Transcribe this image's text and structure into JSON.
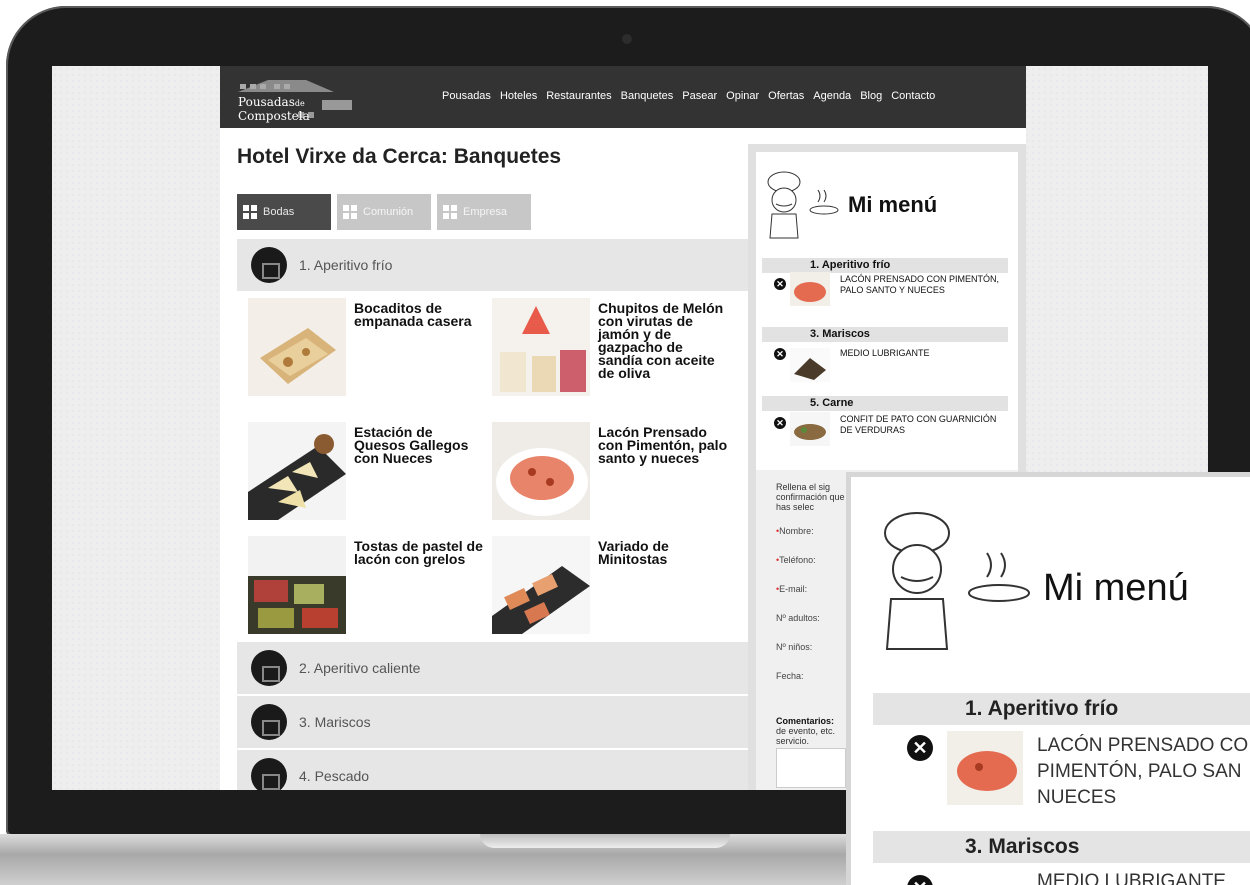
{
  "site": {
    "logo_text_line1": "Pousadas",
    "logo_text_de": "de",
    "logo_text_line2": "Compostela",
    "nav": [
      "Pousadas",
      "Hoteles",
      "Restaurantes",
      "Banquetes",
      "Pasear",
      "Opinar",
      "Ofertas",
      "Agenda",
      "Blog",
      "Contacto"
    ]
  },
  "page": {
    "title": "Hotel Virxe da Cerca: Banquetes",
    "tabs": [
      "Bodas",
      "Comunión",
      "Empresa"
    ],
    "active_tab": "Bodas",
    "sections": [
      "1. Aperitivo frío",
      "2. Aperitivo caliente",
      "3. Mariscos",
      "4. Pescado"
    ],
    "dishes": [
      "Bocaditos de empanada casera",
      "Chupitos de Melón con virutas de jamón y de gazpacho de sandía con aceite de oliva",
      "Estación de Quesos Gallegos con Nueces",
      "Lacón Prensado con Pimentón, palo santo y nueces",
      "Tostas de pastel de lacón con grelos",
      "Variado de Minitostas"
    ]
  },
  "my_menu": {
    "title": "Mi menú",
    "groups": [
      {
        "category": "1. Aperitivo frío",
        "item": "LACÓN PRENSADO CON PIMENTÓN, PALO SANTO Y NUECES"
      },
      {
        "category": "3. Mariscos",
        "item": "MEDIO LUBRIGANTE"
      },
      {
        "category": "5. Carne",
        "item": "CONFIT DE PATO CON GUARNICIÓN DE VERDURAS"
      }
    ],
    "remove_glyph": "✕"
  },
  "form": {
    "intro": "Rellena el sig confirmación que has selec",
    "fields": [
      "Nombre:",
      "Teléfono:",
      "E-mail:",
      "Nº adultos:",
      "Nº niños:",
      "Fecha:"
    ],
    "required_marker": "•",
    "comments_label": "Comentarios:",
    "comments_hint": "de evento, etc. servicio."
  },
  "zoom": {
    "title": "Mi menú",
    "cat1": "1. Aperitivo frío",
    "item1_line1": "LACÓN PRENSADO CO",
    "item1_line2": "PIMENTÓN, PALO SAN",
    "item1_line3": "NUECES",
    "cat2": "3. Mariscos",
    "item2_line1": "MEDIO LUBRIGANTE"
  }
}
